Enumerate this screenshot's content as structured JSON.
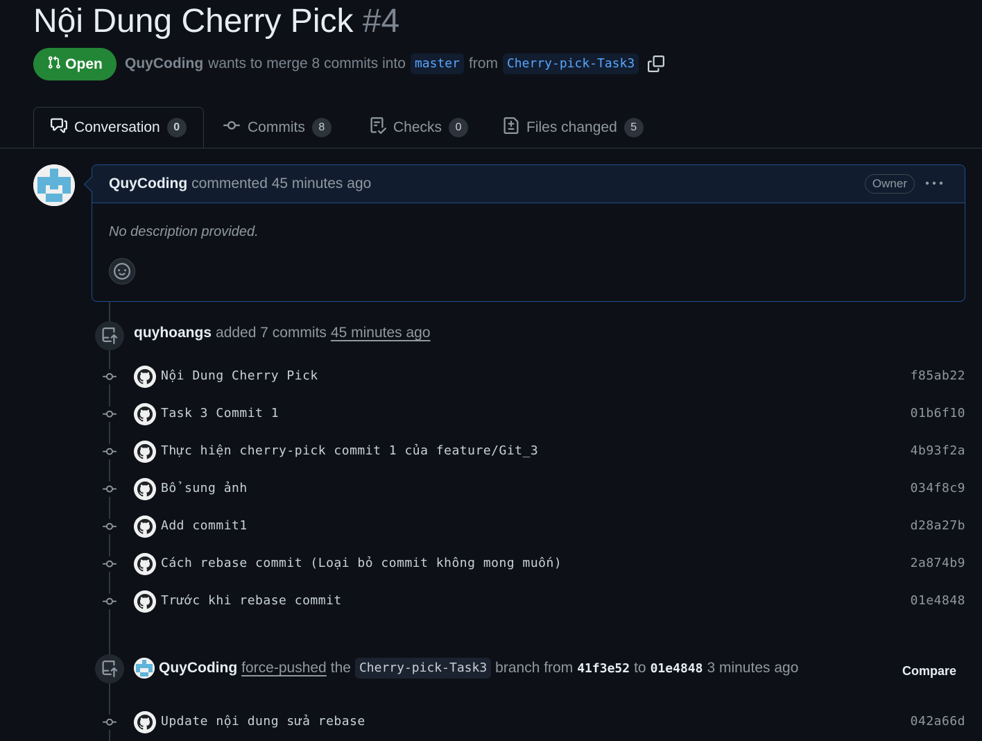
{
  "pr": {
    "title": "Nội Dung Cherry Pick",
    "number": "#4",
    "state": "Open",
    "author": "QuyCoding",
    "merge_text": "wants to merge 8 commits into",
    "base_branch": "master",
    "from_text": "from",
    "head_branch": "Cherry-pick-Task3"
  },
  "tabs": [
    {
      "label": "Conversation",
      "count": "0"
    },
    {
      "label": "Commits",
      "count": "8"
    },
    {
      "label": "Checks",
      "count": "0"
    },
    {
      "label": "Files changed",
      "count": "5"
    }
  ],
  "comment": {
    "author": "QuyCoding",
    "action": "commented 45 minutes ago",
    "badge": "Owner",
    "body": "No description provided."
  },
  "commit_event": {
    "author": "quyhoangs",
    "text": "added 7 commits",
    "time": "45 minutes ago"
  },
  "commits": [
    {
      "message": "Nội Dung Cherry Pick",
      "sha": "f85ab22"
    },
    {
      "message": "Task 3 Commit 1",
      "sha": "01b6f10"
    },
    {
      "message": "Thực hiện cherry-pick commit 1 của feature/Git_3",
      "sha": "4b93f2a"
    },
    {
      "message": "Bổ sung ảnh",
      "sha": "034f8c9"
    },
    {
      "message": "Add commit1",
      "sha": "d28a27b"
    },
    {
      "message": "Cách rebase commit (Loại bỏ commit không mong muốn)",
      "sha": "2a874b9"
    },
    {
      "message": "Trước khi rebase commit",
      "sha": "01e4848"
    }
  ],
  "push_event": {
    "author": "QuyCoding",
    "action": "force-pushed",
    "the_text": "the",
    "branch": "Cherry-pick-Task3",
    "branch_from_text": "branch from",
    "from_sha": "41f3e52",
    "to_text": "to",
    "to_sha": "01e4848",
    "time": "3 minutes ago",
    "compare_label": "Compare"
  },
  "last_commit": {
    "message": "Update nội dung sửa rebase",
    "sha": "042a66d"
  },
  "colors": {
    "background": "#0d1117",
    "open_green": "#238636",
    "link_blue": "#58a6ff",
    "comment_border": "#1f4d8c"
  },
  "icons": [
    "git-pull-request-icon",
    "copy-icon",
    "comment-discussion-icon",
    "git-commit-icon",
    "checklist-icon",
    "file-diff-icon",
    "kebab-horizontal-icon",
    "smiley-icon",
    "repo-push-icon",
    "github-mark-icon"
  ]
}
